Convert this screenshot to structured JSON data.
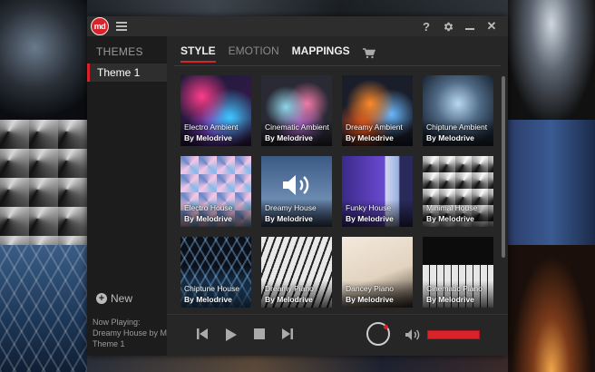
{
  "window": {
    "logo_text": "md",
    "title_buttons": {
      "help": "?",
      "settings": "gear-icon",
      "minimize": "minimize-icon",
      "close": "✕"
    }
  },
  "sidebar": {
    "title": "THEMES",
    "items": [
      {
        "label": "Theme 1",
        "selected": true
      }
    ],
    "new_label": "New"
  },
  "now_playing": {
    "label": "Now Playing:",
    "track": "Dreamy House by Melodrive",
    "theme": "Theme 1"
  },
  "tabs": [
    {
      "label": "STYLE",
      "active": true
    },
    {
      "label": "EMOTION",
      "active": false
    },
    {
      "label": "MAPPINGS",
      "active": false
    }
  ],
  "cart_icon": "cart-icon",
  "styles": [
    {
      "name": "Electro Ambient",
      "author": "By Melodrive"
    },
    {
      "name": "Cinematic Ambient",
      "author": "By Melodrive"
    },
    {
      "name": "Dreamy Ambient",
      "author": "By Melodrive"
    },
    {
      "name": "Chiptune Ambient",
      "author": "By Melodrive"
    },
    {
      "name": "Electro House",
      "author": "By Melodrive"
    },
    {
      "name": "Dreamy House",
      "author": "By Melodrive",
      "playing": true
    },
    {
      "name": "Funky House",
      "author": "By Melodrive"
    },
    {
      "name": "Minimal House",
      "author": "By Melodrive"
    },
    {
      "name": "Chiptune House",
      "author": "By Melodrive"
    },
    {
      "name": "Dreamy Piano",
      "author": "By Melodrive"
    },
    {
      "name": "Dancey Piano",
      "author": "By Melodrive"
    },
    {
      "name": "Cinematic Piano",
      "author": "By Melodrive"
    }
  ],
  "player": {
    "controls": [
      "previous-icon",
      "play-icon",
      "stop-icon",
      "next-icon"
    ],
    "volume_icon": "volume-icon"
  },
  "colors": {
    "accent": "#d8232a",
    "panel": "#262626",
    "sidebar": "#1c1c1c"
  }
}
